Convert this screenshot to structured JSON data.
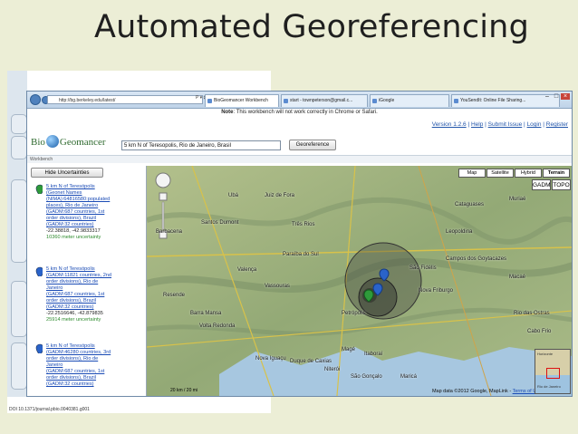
{
  "slide": {
    "title": "Automated Georeferencing"
  },
  "figure": {
    "doi": "DOI 10.1371/journal.pbio.0040381.g001"
  },
  "browser": {
    "url": "http://bg.berkeley.edu/latest/",
    "url_icons": "P ▾ ⊠ C ×",
    "tabs": [
      {
        "label": "BioGeomancer Workbench",
        "active": true
      },
      {
        "label": "start - townpeterson@gmail.c...",
        "active": false
      },
      {
        "label": "iGoogle",
        "active": false
      },
      {
        "label": "YouSendIt: Online File Sharing...",
        "active": false
      }
    ]
  },
  "page": {
    "note_bold": "Note",
    "note_text": ": This workbench will not work correctly in Chrome or Safari.",
    "links": {
      "version": "Version 1.2.6",
      "help": "Help",
      "submit_issue": "Submit Issue",
      "login": "Login",
      "register": "Register"
    },
    "logo": {
      "part1": "Bio",
      "part2": "Geomancer"
    },
    "search_value": "5 km N of Teresopolis, Rio de Janeiro, Brasil",
    "georeference_label": "Georeference",
    "workbench_label": "Workbench",
    "hide_uncertainties_label": "Hide Uncertainties"
  },
  "results": [
    {
      "pin_color": "#2e9a3a",
      "lines": [
        "5 km N of Teresópolis",
        "(Geonet Names",
        "(NIMA):64816580:populated",
        "places), Rio de Janeiro",
        "(GADM:687 countries, 1st",
        "order divisions), Brazil",
        "(GADM:32 countries)"
      ],
      "coords": "-22.38818, -42.9833317",
      "uncertainty": "10360 meter uncertainty"
    },
    {
      "pin_color": "#2a63c9",
      "lines": [
        "5 km N of Teresópolis",
        "(GADM:11821 countries, 2nd",
        "order divisions), Rio de",
        "Janeiro",
        "(GADM:687 countries, 1st",
        "order divisions), Brazil",
        "(GADM:32 countries)"
      ],
      "coords": "-22.2516646, -42.879835",
      "uncertainty": "25914 meter uncertainty"
    },
    {
      "pin_color": "#2a63c9",
      "lines": [
        "5 km N of Teresópolis",
        "(GADM:46280 countries, 3rd",
        "order divisions), Rio de",
        "Janeiro",
        "(GADM:687 countries, 1st",
        "order divisions), Brazil",
        "(GADM:32 countries)"
      ],
      "coords": "",
      "uncertainty": ""
    }
  ],
  "map": {
    "types": [
      "Map",
      "Satellite",
      "Hybrid",
      "Terrain"
    ],
    "selected_type": "Terrain",
    "layer_tabs": [
      "GADM",
      "TOPO"
    ],
    "labels": [
      "Juiz de Fora",
      "Três Rios",
      "Muriaé",
      "Cataguases",
      "Leopoldina",
      "Petrópolis",
      "Nova Friburgo",
      "Macaé",
      "Resende",
      "Barra Mansa",
      "Volta Redonda",
      "Nova Iguaçu",
      "Duque de Caxias",
      "Niterói",
      "São Gonçalo",
      "Maricá",
      "Itaboraí",
      "Magé",
      "Cabo Frio",
      "Rio das Ostras",
      "Valença",
      "Vassouras",
      "Paraíba do Sul",
      "Santos Dumont",
      "Barbacena",
      "Ubá",
      "Campos dos Goytacazes",
      "São Fidélis"
    ],
    "copyright": "Map data ©2012 Google, MapLink",
    "terms": "Terms of Use",
    "scale": "20 km / 20 mi",
    "overview_labels": [
      "Horizonte",
      "Rio de Janeiro"
    ]
  }
}
